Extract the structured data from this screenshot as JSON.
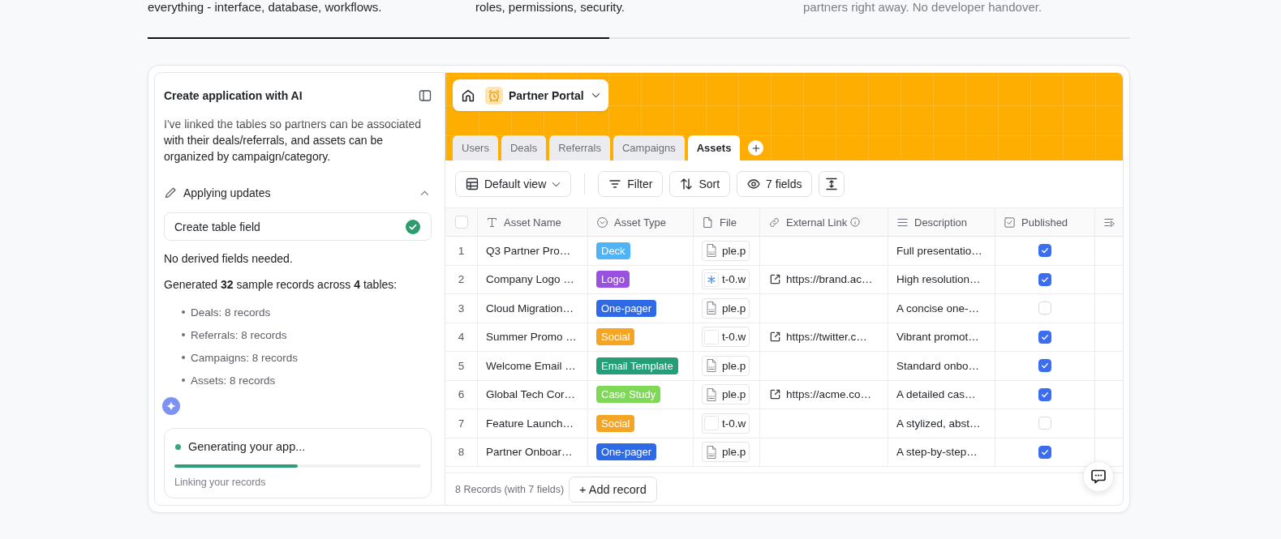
{
  "steps": {
    "items": [
      {
        "text": "everything - interface, database, workflows.",
        "active": true
      },
      {
        "text": "roles, permissions, security.",
        "active": true
      },
      {
        "text": "partners right away. No developer handover.",
        "active": false
      }
    ],
    "level": 0.47
  },
  "assistant": {
    "title": "Create application with AI",
    "message": "I've linked the tables so partners can be associated with their deals/referrals, and assets can be organized by campaign/category.",
    "task": {
      "label": "Applying updates",
      "expanded": true,
      "steps": [
        {
          "label": "Create table field",
          "done": true
        }
      ]
    },
    "notes": [
      "No derived fields needed.",
      "Generated **32** sample records across **4** tables:"
    ],
    "bullets": [
      "Deals: 8 records",
      "Referrals: 8 records",
      "Campaigns: 8 records",
      "Assets: 8 records"
    ],
    "status": {
      "title": "Generating your app...",
      "level": 0.5,
      "detail": "Linking your records"
    }
  },
  "app": {
    "name": "Partner Portal",
    "tabs": [
      {
        "label": "Users",
        "selected": false
      },
      {
        "label": "Deals",
        "selected": false
      },
      {
        "label": "Referrals",
        "selected": false
      },
      {
        "label": "Campaigns",
        "selected": false
      },
      {
        "label": "Assets",
        "selected": true
      }
    ],
    "toolbar": {
      "view": "Default view",
      "buttons": [
        {
          "kind": "filter",
          "label": "Filter"
        },
        {
          "kind": "sort",
          "label": "Sort"
        },
        {
          "kind": "fields",
          "label": "7 fields"
        },
        {
          "kind": "row-height"
        }
      ]
    },
    "table": {
      "select_all_checked": false,
      "columns": [
        {
          "label": "Asset Name",
          "kind": "text"
        },
        {
          "label": "Asset Type",
          "kind": "select"
        },
        {
          "label": "File",
          "kind": "file"
        },
        {
          "label": "External Link",
          "kind": "url",
          "info": true
        },
        {
          "label": "Description",
          "kind": "longtext"
        },
        {
          "label": "Published",
          "kind": "checkbox"
        }
      ],
      "rows": [
        {
          "number": "1",
          "name": "Q3 Partner Pro…",
          "type": {
            "label": "Deck",
            "color": "#4fb3f6"
          },
          "file": {
            "kind": "pdf",
            "name": "ple.p"
          },
          "description": "Full presentatio…",
          "published": true
        },
        {
          "number": "2",
          "name": "Company Logo …",
          "type": {
            "label": "Logo",
            "color": "#9b51e0"
          },
          "file": {
            "kind": "image",
            "name": "t-0.w"
          },
          "link": "https://brand.ac…",
          "description": "High resolution…",
          "published": true
        },
        {
          "number": "3",
          "name": "Cloud Migration…",
          "type": {
            "label": "One-pager",
            "color": "#2f6ae6"
          },
          "file": {
            "kind": "pdf",
            "name": "ple.p"
          },
          "description": "A concise one-…",
          "published": false
        },
        {
          "number": "4",
          "name": "Summer Promo …",
          "type": {
            "label": "Social",
            "color": "#f5a524"
          },
          "file": {
            "kind": "blank",
            "name": "t-0.w"
          },
          "link": "https://twitter.c…",
          "description": "Vibrant promot…",
          "published": true
        },
        {
          "number": "5",
          "name": "Welcome Email …",
          "type": {
            "label": "Email Template",
            "color": "#239e77"
          },
          "file": {
            "kind": "pdf",
            "name": "ple.p"
          },
          "description": "Standard onbo…",
          "published": true
        },
        {
          "number": "6",
          "name": "Global Tech Cor…",
          "type": {
            "label": "Case Study",
            "color": "#7ed957"
          },
          "file": {
            "kind": "pdf",
            "name": "ple.p"
          },
          "link": "https://acme.co…",
          "description": "A detailed cas…",
          "published": true
        },
        {
          "number": "7",
          "name": "Feature Launch…",
          "type": {
            "label": "Social",
            "color": "#f5a524"
          },
          "file": {
            "kind": "blank",
            "name": "t-0.w"
          },
          "description": "A stylized, abst…",
          "published": false
        },
        {
          "number": "8",
          "name": "Partner Onboar…",
          "type": {
            "label": "One-pager",
            "color": "#2f6ae6"
          },
          "file": {
            "kind": "pdf",
            "name": "ple.p"
          },
          "description": "A step-by-step…",
          "published": true
        }
      ]
    },
    "footer": {
      "summary": "8 Records (with 7 fields)",
      "add_button": "+ Add record"
    }
  }
}
